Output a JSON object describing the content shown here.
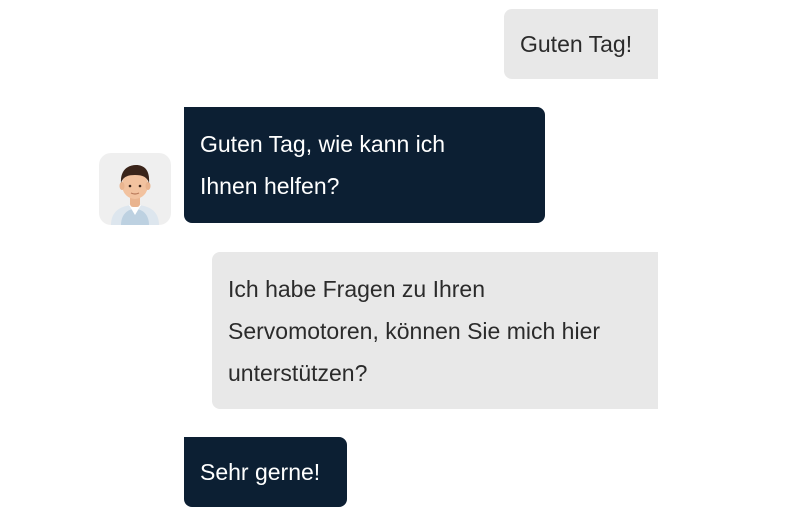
{
  "chat": {
    "messages": [
      {
        "sender": "user",
        "text": "Guten Tag!"
      },
      {
        "sender": "bot",
        "text": "Guten Tag, wie kann ich\nIhnen helfen?"
      },
      {
        "sender": "user",
        "text": "Ich habe Fragen zu Ihren\nServomotoren, können Sie mich hier\nunterstützen?"
      },
      {
        "sender": "bot",
        "text": "Sehr gerne!"
      }
    ],
    "bot_avatar_icon": "support-agent-avatar-icon"
  },
  "colors": {
    "user_bubble": "#e8e8e8",
    "bot_bubble": "#0c1f33",
    "user_text": "#2b2b2b",
    "bot_text": "#ffffff"
  }
}
